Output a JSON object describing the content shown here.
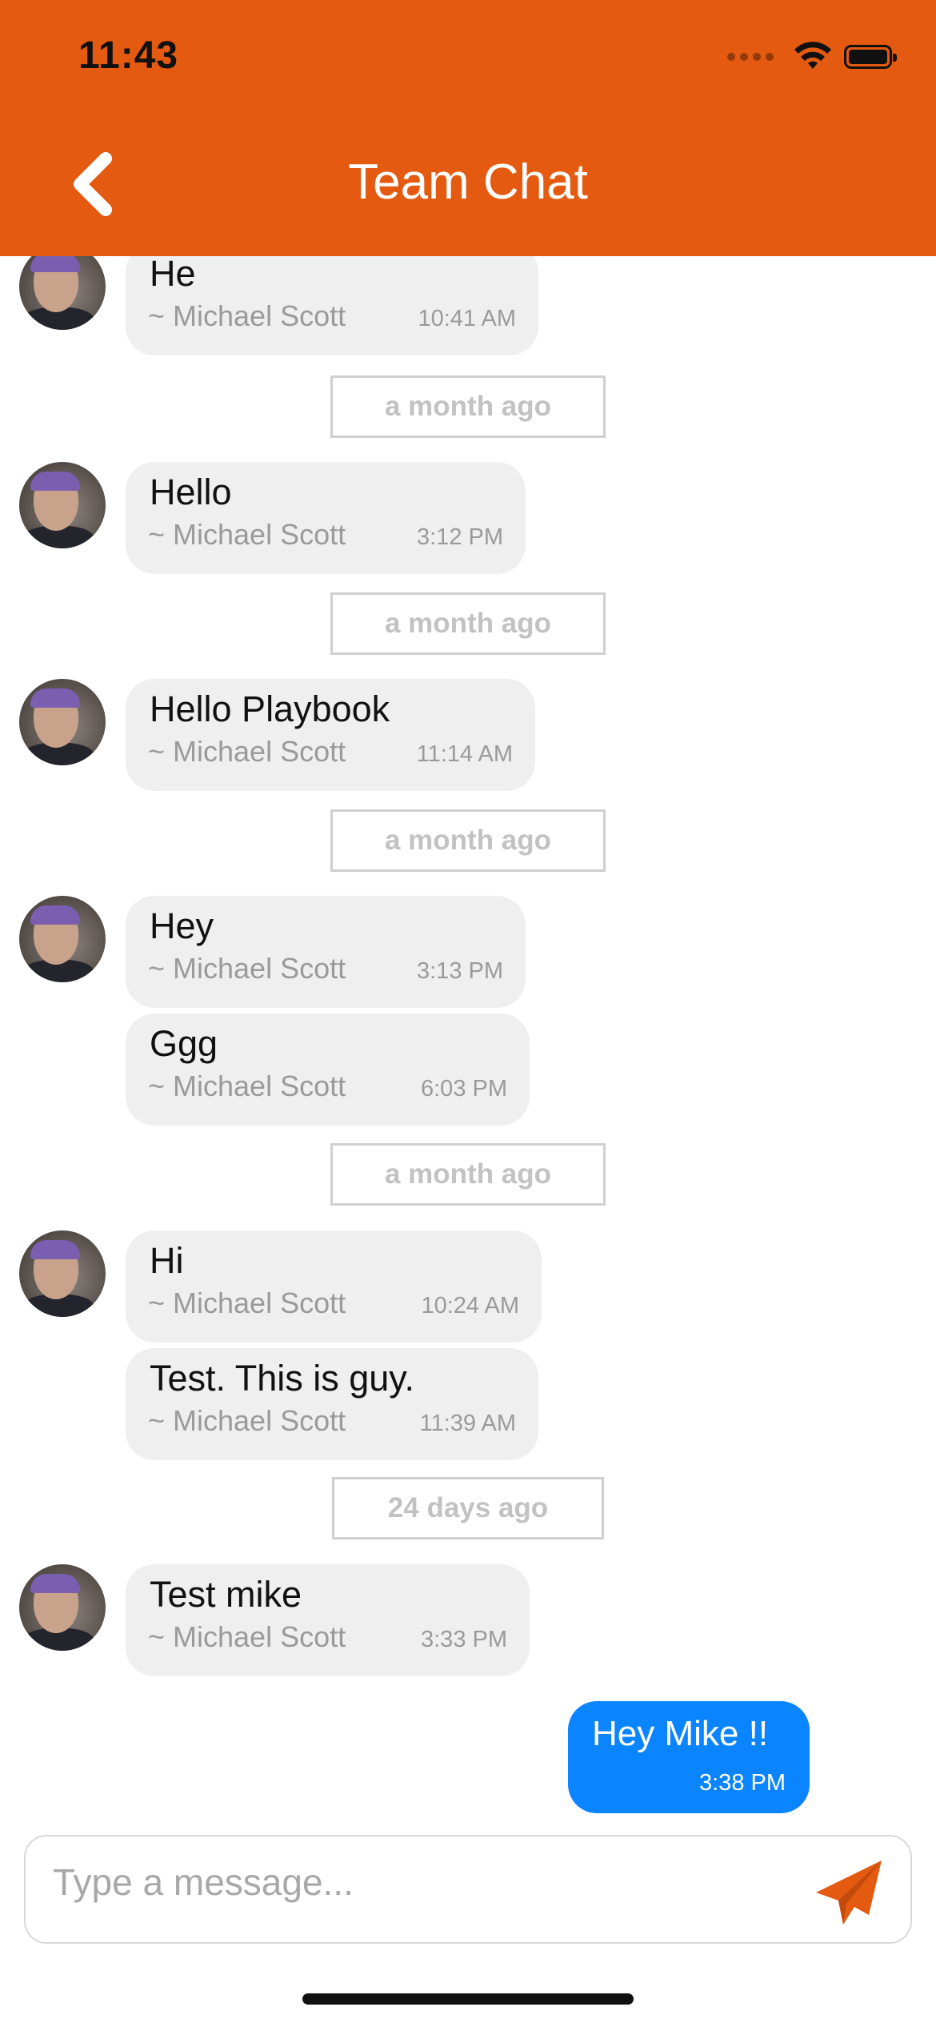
{
  "status_bar": {
    "time": "11:43"
  },
  "header": {
    "title": "Team Chat",
    "back_icon": "chevron-left-icon"
  },
  "colors": {
    "header_bg": "#E35A10",
    "incoming_bubble": "#EFEFEF",
    "outgoing_bubble": "#0A84FF",
    "send_icon": "#E35A10"
  },
  "messages": [
    {
      "text": "He",
      "author": "~ Michael Scott",
      "time": "10:41 AM"
    },
    {
      "separator": "a month ago"
    },
    {
      "text": "Hello",
      "author": "~ Michael Scott",
      "time": "3:12 PM"
    },
    {
      "separator": "a month ago"
    },
    {
      "text": "Hello Playbook",
      "author": "~ Michael Scott",
      "time": "11:14 AM"
    },
    {
      "separator": "a month ago"
    },
    {
      "text": "Hey",
      "author": "~ Michael Scott",
      "time": "3:13 PM"
    },
    {
      "text": "Ggg",
      "author": "~ Michael Scott",
      "time": "6:03 PM"
    },
    {
      "separator": "a month ago"
    },
    {
      "text": "Hi",
      "author": "~ Michael Scott",
      "time": "10:24 AM"
    },
    {
      "text": "Test. This is guy.",
      "author": "~ Michael Scott",
      "time": "11:39 AM"
    },
    {
      "separator": "24 days ago"
    },
    {
      "text": "Test mike",
      "author": "~ Michael Scott",
      "time": "3:33 PM"
    },
    {
      "text": "Hey Mike !!",
      "time": "3:38 PM",
      "outgoing": true
    }
  ],
  "composer": {
    "placeholder": "Type a message...",
    "value": "",
    "send_icon": "send-icon"
  }
}
